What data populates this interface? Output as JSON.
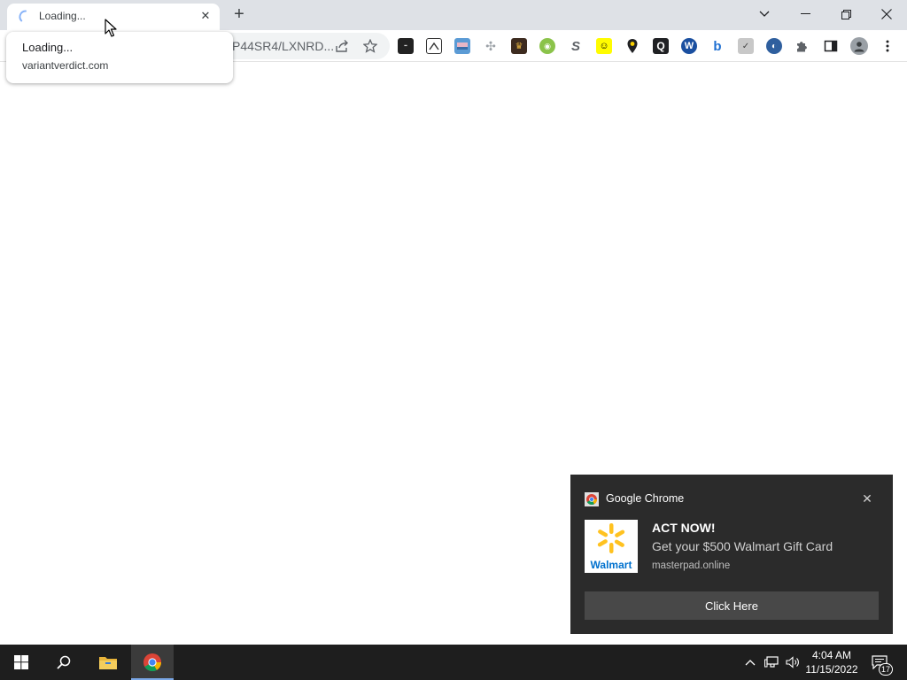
{
  "tab": {
    "title": "Loading..."
  },
  "hover_card": {
    "title": "Loading...",
    "domain": "variantverdict.com"
  },
  "omnibox": {
    "url": "P44SR4/LXNRD..."
  },
  "notification": {
    "app": "Google Chrome",
    "headline": "ACT NOW!",
    "body": "Get your $500 Walmart Gift Card",
    "source": "masterpad.online",
    "action": "Click Here",
    "image_brand": "Walmart"
  },
  "taskbar": {
    "time": "4:04 AM",
    "date": "11/15/2022",
    "notification_count": "17"
  },
  "colors": {
    "tabstrip": "#dee1e6",
    "toast_bg": "#2b2b2b",
    "toast_button": "#484848",
    "taskbar": "#1e1e1e",
    "walmart_blue": "#0071ce",
    "walmart_yellow": "#ffc220"
  }
}
